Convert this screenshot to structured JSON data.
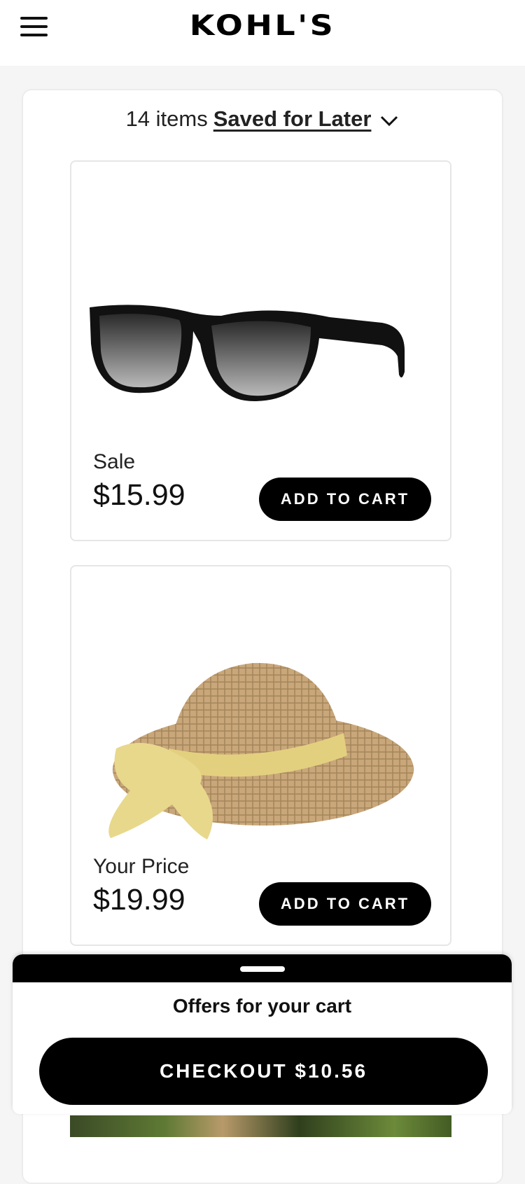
{
  "header": {
    "logo": "KOHL'S",
    "menu_icon": "hamburger-menu-icon"
  },
  "saved": {
    "count_text": "14 items",
    "title": "Saved for Later",
    "toggle_icon": "chevron-down-icon"
  },
  "products": [
    {
      "image": "sunglasses",
      "price_label": "Sale",
      "price": "$15.99",
      "button_label": "ADD TO CART"
    },
    {
      "image": "straw-sun-hat",
      "price_label": "Your Price",
      "price": "$19.99",
      "button_label": "ADD TO CART"
    }
  ],
  "sheet": {
    "offers_title": "Offers for your cart",
    "checkout_label": "CHECKOUT $10.56"
  },
  "colors": {
    "brand": "#000000",
    "background": "#f5f5f5"
  }
}
